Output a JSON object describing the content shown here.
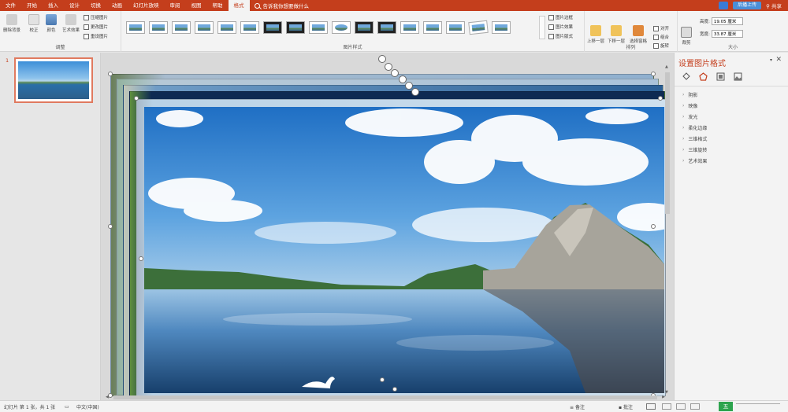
{
  "tabs": [
    "文件",
    "开始",
    "插入",
    "设计",
    "切换",
    "动画",
    "幻灯片放映",
    "审阅",
    "视图",
    "帮助",
    "格式"
  ],
  "active_tab": "格式",
  "tell_me": "告诉我你想要做什么",
  "upload_label": "后播上传",
  "share_label": "共享",
  "ribbon": {
    "remove_bg": "删除背景",
    "correct": "校正",
    "color": "颜色",
    "art_effect": "艺术效果",
    "compress": "压缩图片",
    "change": "更改图片",
    "reset": "重设图片",
    "adjust_label": "调整",
    "styles_label": "图片样式",
    "border": "图片边框",
    "effect": "图片效果",
    "layout": "图片版式",
    "forward": "上移一层",
    "backward": "下移一层",
    "selection": "选择窗格",
    "align": "对齐",
    "group": "组合",
    "rotate": "旋转",
    "arrange_label": "排列",
    "crop": "裁剪",
    "height_label": "高度:",
    "height_value": "19.05 厘米",
    "width_label": "宽度:",
    "width_value": "33.87 厘米",
    "size_label": "大小"
  },
  "slides": {
    "number": "1"
  },
  "task_pane": {
    "title": "设置图片格式",
    "options": [
      "阴影",
      "映像",
      "发光",
      "柔化边缘",
      "三维格式",
      "三维旋转",
      "艺术效果"
    ]
  },
  "status": {
    "slide_info": "幻灯片 第 1 张，共 1 张",
    "language": "中文(中国)",
    "notes": "备注",
    "comments": "批注",
    "ime": "五"
  },
  "colors": {
    "accent": "#c43e1c",
    "ribbon_bg": "#f3f3f3"
  }
}
